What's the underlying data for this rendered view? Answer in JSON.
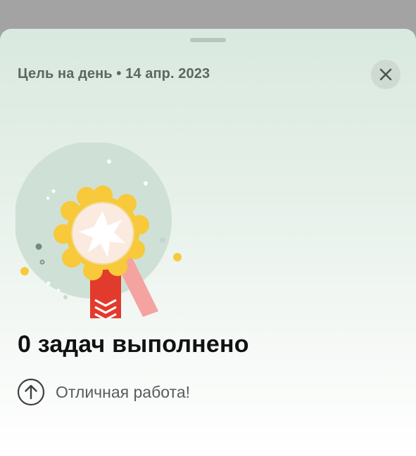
{
  "header": {
    "goal_label": "Цель на день",
    "separator": "•",
    "date": "14 апр. 2023",
    "close_icon": "close-icon"
  },
  "badge": {
    "icon": "award-medal-icon",
    "colors": {
      "circle": "#cfe1d6",
      "medal_petals": "#f7c93b",
      "medal_face": "#fbeadf",
      "ribbon_front": "#e23a2d",
      "ribbon_back": "#f4a3a0"
    }
  },
  "summary": {
    "headline": "0 задач выполнено",
    "praise_icon": "arrow-up-circle-icon",
    "praise": "Отличная работа!"
  }
}
